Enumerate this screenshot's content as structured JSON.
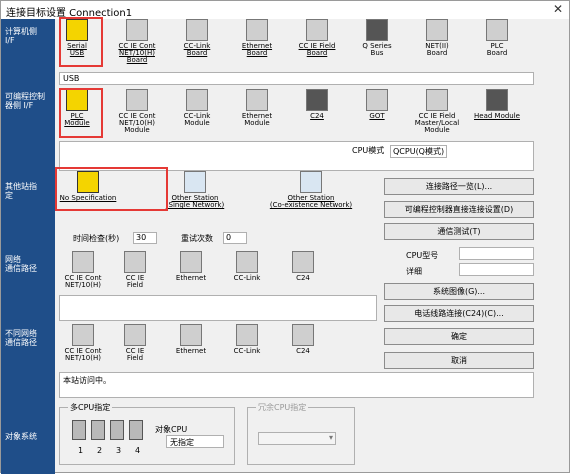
{
  "window": {
    "title": "连接目标设置 Connection1",
    "close": "✕"
  },
  "left_labels": {
    "pc_if": "计算机侧\nI/F",
    "plc_if": "可编程控制\n器侧 I/F",
    "other_station": "其他站指\n定",
    "network_route": "网络\n通信路径",
    "diff_network_route": "不同网络\n通信路径",
    "target_system": "对象系统"
  },
  "pc_if_items": [
    "Serial\nUSB",
    "CC IE Cont\nNET/10(H)\nBoard",
    "CC-Link\nBoard",
    "Ethernet\nBoard",
    "CC IE Field\nBoard",
    "Q Series\nBus",
    "NET(II)\nBoard",
    "PLC\nBoard"
  ],
  "pc_if_value": "USB",
  "plc_if_items": [
    "PLC\nModule",
    "CC IE Cont\nNET/10(H)\nModule",
    "CC-Link\nModule",
    "Ethernet\nModule",
    "C24",
    "GOT",
    "CC IE Field\nMaster/Local\nModule",
    "Head Module"
  ],
  "cpu_mode_label": "CPU模式",
  "cpu_mode_value": "QCPU(Q模式)",
  "other_station_items": [
    "No Specification",
    "Other Station\n(Single Network)",
    "Other Station\n(Co-existence Network)"
  ],
  "timeout_label": "时间检查(秒)",
  "timeout_value": "30",
  "retry_label": "重试次数",
  "retry_value": "0",
  "right_buttons": [
    "连接路径一览(L)...",
    "可编程控制器直接连接设置(D)",
    "通信测试(T)",
    "系统图像(G)...",
    "电话线路连接(C24)(C)...",
    "确定",
    "取消"
  ],
  "cpu_type_label": "CPU型号",
  "detail_label": "详细",
  "network_items": [
    "CC IE Cont\nNET/10(H)",
    "CC IE\nField",
    "Ethernet",
    "CC-Link",
    "C24"
  ],
  "diff_network_items": [
    "CC IE Cont\nNET/10(H)",
    "CC IE\nField",
    "Ethernet",
    "CC-Link",
    "C24"
  ],
  "status_text": "本站访问中。",
  "multi_cpu": {
    "title": "多CPU指定",
    "nums": [
      "1",
      "2",
      "3",
      "4"
    ],
    "target_label": "对象CPU",
    "target_value": "无指定"
  },
  "redundant_cpu": {
    "title": "冗余CPU指定"
  }
}
